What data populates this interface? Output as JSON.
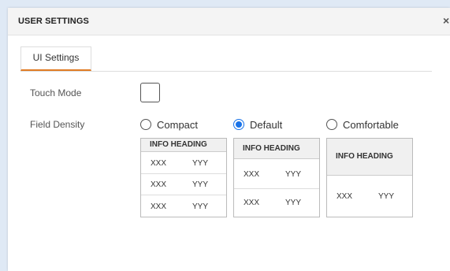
{
  "dialog": {
    "title": "USER SETTINGS",
    "close_glyph": "×"
  },
  "tabs": [
    {
      "label": "UI Settings",
      "active": true
    }
  ],
  "settings": {
    "touch_mode": {
      "label": "Touch Mode",
      "checked": false
    },
    "field_density": {
      "label": "Field Density",
      "selected": "Default",
      "options": [
        {
          "label": "Compact",
          "checked": false
        },
        {
          "label": "Default",
          "checked": true
        },
        {
          "label": "Comfortable",
          "checked": false
        }
      ]
    }
  },
  "previews": [
    {
      "heading": "INFO HEADING",
      "rows": [
        [
          "XXX",
          "YYY"
        ],
        [
          "XXX",
          "YYY"
        ],
        [
          "XXX",
          "YYY"
        ]
      ]
    },
    {
      "heading": "INFO HEADING",
      "rows": [
        [
          "XXX",
          "YYY"
        ],
        [
          "XXX",
          "YYY"
        ]
      ]
    },
    {
      "heading": "INFO HEADING",
      "rows": [
        [
          "XXX",
          "YYY"
        ]
      ]
    }
  ],
  "colors": {
    "accent": "#1a73e8",
    "tab_underline": "#e07b24",
    "page_bg": "#dfe9f5"
  }
}
